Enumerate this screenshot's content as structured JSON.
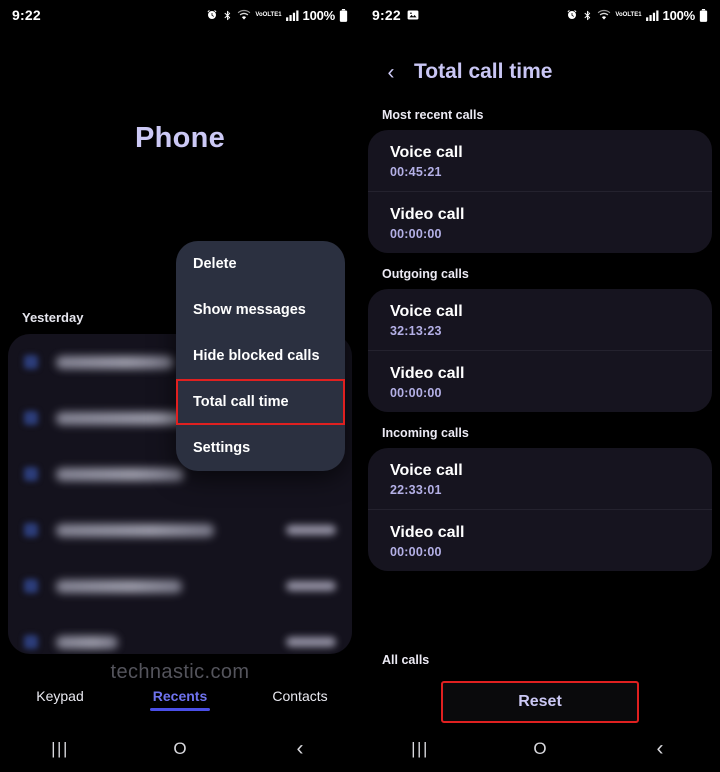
{
  "left": {
    "status": {
      "time": "9:22",
      "battery_percent": "100%",
      "volte_line1": "VoO",
      "volte_line2": "LTE1",
      "icons": [
        "alarm-icon",
        "bluetooth-icon",
        "wifi-icon",
        "volte-icon",
        "signal-icon",
        "battery-icon"
      ]
    },
    "app_title": "Phone",
    "day_label": "Yesterday",
    "call_rows": [
      {
        "name_width": 118,
        "has_time": false
      },
      {
        "name_width": 172,
        "has_time": false
      },
      {
        "name_width": 128,
        "has_time": false
      },
      {
        "name_width": 158,
        "has_time": true
      },
      {
        "name_width": 126,
        "has_time": true
      },
      {
        "name_width": 62,
        "has_time": true
      }
    ],
    "menu": {
      "items": [
        {
          "label": "Delete",
          "highlighted": false
        },
        {
          "label": "Show messages",
          "highlighted": false
        },
        {
          "label": "Hide blocked calls",
          "highlighted": false
        },
        {
          "label": "Total call time",
          "highlighted": true
        },
        {
          "label": "Settings",
          "highlighted": false
        }
      ]
    },
    "watermark": "technastic.com",
    "tabs": [
      {
        "label": "Keypad",
        "active": false
      },
      {
        "label": "Recents",
        "active": true
      },
      {
        "label": "Contacts",
        "active": false
      }
    ]
  },
  "right": {
    "status": {
      "time": "9:22",
      "battery_percent": "100%",
      "volte_line1": "VoO",
      "volte_line2": "LTE1",
      "screenshot_icon": "image-icon"
    },
    "header": {
      "back_icon": "chevron-left-icon",
      "title": "Total call time"
    },
    "sections": [
      {
        "label": "Most recent calls",
        "rows": [
          {
            "title": "Voice call",
            "value": "00:45:21"
          },
          {
            "title": "Video call",
            "value": "00:00:00"
          }
        ]
      },
      {
        "label": "Outgoing calls",
        "rows": [
          {
            "title": "Voice call",
            "value": "32:13:23"
          },
          {
            "title": "Video call",
            "value": "00:00:00"
          }
        ]
      },
      {
        "label": "Incoming calls",
        "rows": [
          {
            "title": "Voice call",
            "value": "22:33:01"
          },
          {
            "title": "Video call",
            "value": "00:00:00"
          }
        ]
      }
    ],
    "all_calls_label": "All calls",
    "reset_label": "Reset"
  },
  "navbar": {
    "recents_icon": "|||",
    "home_icon": "O",
    "back_icon": "‹"
  },
  "colors": {
    "accent_lavender": "#c9c6f4",
    "highlight_red": "#e02020",
    "tab_active": "#4a4fe8",
    "menu_bg": "#2b3040",
    "card_bg": "#16141f"
  }
}
